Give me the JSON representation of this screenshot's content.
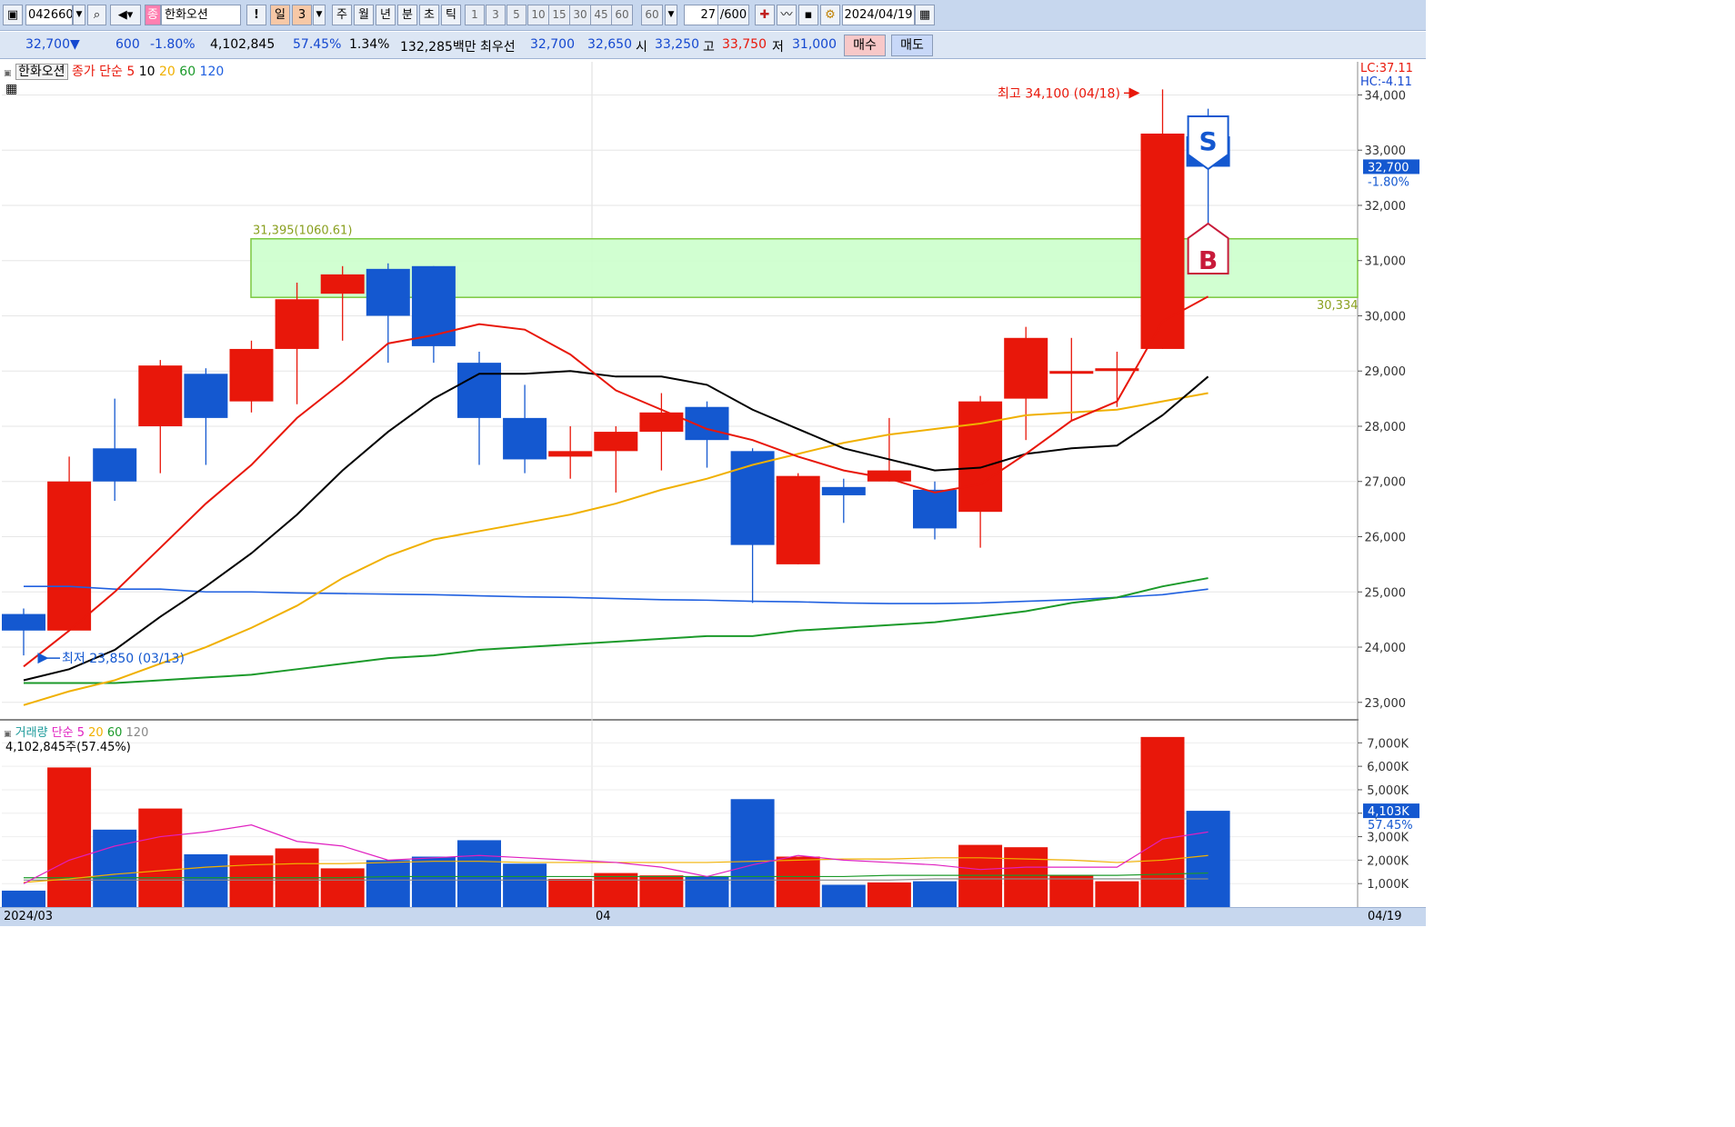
{
  "toolbar": {
    "code": "042660",
    "market_badge": "종",
    "name": "한화오션",
    "alert": "!",
    "period_day": "일",
    "period_n": "3",
    "periods": [
      "주",
      "월",
      "년",
      "분",
      "초",
      "틱"
    ],
    "intervals": [
      "1",
      "3",
      "5",
      "10",
      "15",
      "30",
      "45",
      "60"
    ],
    "interval_custom": "60",
    "count": "27",
    "count_max": "/600",
    "date": "2024/04/19"
  },
  "quote": {
    "price": "32,700▼",
    "change": "600",
    "change_pct": "-1.80%",
    "volume": "4,102,845",
    "vol_ratio": "57.45%",
    "turnover": "1.34%",
    "amount": "132,285백만",
    "best_label": "최우선",
    "best_ask": "32,700",
    "best_bid": "32,650",
    "open_label": "시",
    "open": "33,250",
    "high_label": "고",
    "high": "33,750",
    "low_label": "저",
    "low": "31,000",
    "buy_button": "매수",
    "sell_button": "매도"
  },
  "price_legend": {
    "name": "한화오션",
    "close_label": "종가 단순",
    "ma_periods": [
      "5",
      "10",
      "20",
      "60",
      "120"
    ],
    "ma_colors": [
      "#e8170a",
      "#000000",
      "#f0b000",
      "#1b9a2a",
      "#2060e0"
    ],
    "lc": "LC:37.11",
    "hc": "HC:-4.11"
  },
  "annotations": {
    "high_marker": "최고 34,100 (04/18)",
    "low_marker": "최저 23,850 (03/13)",
    "box_top_label": "31,395(1060.61)",
    "box_bottom_label": "30,334",
    "sell_signal": "S",
    "buy_signal": "B"
  },
  "axis_badges": {
    "price": "32,700",
    "price_pct": "-1.80%",
    "volume": "4,103K",
    "volume_pct": "57.45%"
  },
  "volume_legend": {
    "name": "거래량",
    "ma_label": "단순",
    "ma_periods": [
      "5",
      "20",
      "60",
      "120"
    ],
    "ma_colors": [
      "#e020c0",
      "#f0b000",
      "#1b9a2a",
      "#888888"
    ],
    "summary": "4,102,845주(57.45%)"
  },
  "dates": {
    "start": "2024/03",
    "mid": "04",
    "end": "04/19"
  },
  "colors": {
    "up": "#e8170a",
    "down": "#1458d0",
    "box": "#ccffcc"
  },
  "chart_data": {
    "type": "candlestick",
    "x_unit": "trading day",
    "candles": [
      {
        "open": 24600,
        "high": 24700,
        "low": 23850,
        "close": 24300
      },
      {
        "open": 24300,
        "high": 27450,
        "low": 24300,
        "close": 27000
      },
      {
        "open": 27600,
        "high": 28500,
        "low": 26650,
        "close": 27000
      },
      {
        "open": 28000,
        "high": 29200,
        "low": 27150,
        "close": 29100
      },
      {
        "open": 28950,
        "high": 29050,
        "low": 27300,
        "close": 28150
      },
      {
        "open": 28450,
        "high": 29550,
        "low": 28250,
        "close": 29400
      },
      {
        "open": 29400,
        "high": 30600,
        "low": 28400,
        "close": 30300
      },
      {
        "open": 30400,
        "high": 30900,
        "low": 29550,
        "close": 30750
      },
      {
        "open": 30850,
        "high": 30950,
        "low": 29150,
        "close": 30000
      },
      {
        "open": 30900,
        "high": 30900,
        "low": 29150,
        "close": 29450
      },
      {
        "open": 29150,
        "high": 29350,
        "low": 27300,
        "close": 28150
      },
      {
        "open": 28150,
        "high": 28750,
        "low": 27150,
        "close": 27400
      },
      {
        "open": 27450,
        "high": 28000,
        "low": 27050,
        "close": 27550
      },
      {
        "open": 27550,
        "high": 28000,
        "low": 26800,
        "close": 27900
      },
      {
        "open": 27900,
        "high": 28600,
        "low": 27200,
        "close": 28250
      },
      {
        "open": 28350,
        "high": 28450,
        "low": 27250,
        "close": 27750
      },
      {
        "open": 27550,
        "high": 27600,
        "low": 24800,
        "close": 25850
      },
      {
        "open": 25500,
        "high": 27150,
        "low": 25500,
        "close": 27100
      },
      {
        "open": 26900,
        "high": 27050,
        "low": 26250,
        "close": 26750
      },
      {
        "open": 27000,
        "high": 28150,
        "low": 27000,
        "close": 27200
      },
      {
        "open": 26850,
        "high": 27000,
        "low": 25950,
        "close": 26150
      },
      {
        "open": 26450,
        "high": 28550,
        "low": 25800,
        "close": 28450
      },
      {
        "open": 28500,
        "high": 29800,
        "low": 27750,
        "close": 29600
      },
      {
        "open": 29000,
        "high": 29600,
        "low": 28100,
        "close": 29000
      },
      {
        "open": 29000,
        "high": 29350,
        "low": 28350,
        "close": 29050
      },
      {
        "open": 29400,
        "high": 34100,
        "low": 29400,
        "close": 33300
      },
      {
        "open": 33250,
        "high": 33750,
        "low": 31000,
        "close": 32700
      }
    ],
    "ma5": [
      23650,
      24300,
      25000,
      25800,
      26600,
      27300,
      28150,
      28800,
      29500,
      29650,
      29850,
      29750,
      29300,
      28650,
      28300,
      27950,
      27750,
      27450,
      27200,
      27050,
      26800,
      26950,
      27500,
      28100,
      28450,
      29900,
      30350
    ],
    "ma10": [
      23400,
      23600,
      23950,
      24550,
      25100,
      25700,
      26400,
      27200,
      27900,
      28500,
      28950,
      28950,
      29000,
      28900,
      28900,
      28750,
      28300,
      27950,
      27600,
      27400,
      27200,
      27250,
      27500,
      27600,
      27650,
      28200,
      28900
    ],
    "ma20": [
      22950,
      23200,
      23400,
      23700,
      24000,
      24350,
      24750,
      25250,
      25650,
      25950,
      26100,
      26250,
      26400,
      26600,
      26850,
      27050,
      27300,
      27500,
      27700,
      27850,
      27950,
      28050,
      28200,
      28250,
      28300,
      28450,
      28600
    ],
    "ma60": [
      23350,
      23350,
      23350,
      23400,
      23450,
      23500,
      23600,
      23700,
      23800,
      23850,
      23950,
      24000,
      24050,
      24100,
      24150,
      24200,
      24200,
      24300,
      24350,
      24400,
      24450,
      24550,
      24650,
      24800,
      24900,
      25100,
      25250
    ],
    "ma120": [
      25100,
      25100,
      25050,
      25050,
      25000,
      25000,
      24980,
      24970,
      24960,
      24950,
      24930,
      24910,
      24900,
      24880,
      24860,
      24850,
      24830,
      24820,
      24800,
      24790,
      24790,
      24800,
      24830,
      24860,
      24900,
      24950,
      25050
    ],
    "volume_k": [
      700,
      5950,
      3300,
      4200,
      2250,
      2200,
      2500,
      1650,
      2000,
      2150,
      2850,
      1850,
      1200,
      1450,
      1350,
      1300,
      4600,
      2150,
      950,
      1050,
      1100,
      2650,
      2550,
      1350,
      1100,
      7250,
      4103
    ],
    "vol_ma5": [
      1000,
      2000,
      2600,
      3000,
      3200,
      3500,
      2800,
      2600,
      2000,
      2100,
      2200,
      2100,
      2000,
      1900,
      1700,
      1300,
      1800,
      2200,
      2000,
      1900,
      1800,
      1600,
      1700,
      1700,
      1700,
      2900,
      3200
    ],
    "vol_ma20": [
      1050,
      1200,
      1400,
      1550,
      1700,
      1800,
      1850,
      1850,
      1900,
      1950,
      1950,
      1900,
      1900,
      1900,
      1900,
      1900,
      1950,
      2000,
      2050,
      2050,
      2100,
      2100,
      2050,
      2000,
      1900,
      2000,
      2200
    ],
    "vol_ma60": [
      1250,
      1250,
      1250,
      1250,
      1250,
      1250,
      1250,
      1250,
      1300,
      1300,
      1300,
      1300,
      1300,
      1300,
      1300,
      1300,
      1300,
      1300,
      1300,
      1350,
      1350,
      1350,
      1350,
      1350,
      1350,
      1400,
      1450
    ],
    "vol_ma120": [
      1150,
      1150,
      1150,
      1150,
      1150,
      1150,
      1150,
      1150,
      1150,
      1150,
      1150,
      1150,
      1150,
      1150,
      1150,
      1150,
      1150,
      1150,
      1150,
      1150,
      1200,
      1200,
      1200,
      1200,
      1200,
      1200,
      1200
    ],
    "price_ylim": [
      22700,
      34600
    ],
    "price_ticks": [
      "34,000",
      "33,000",
      "32,000",
      "31,000",
      "30,000",
      "29,000",
      "28,000",
      "27,000",
      "26,000",
      "25,000",
      "24,000",
      "23,000"
    ],
    "price_tick_values": [
      34000,
      33000,
      32000,
      31000,
      30000,
      29000,
      28000,
      27000,
      26000,
      25000,
      24000,
      23000
    ],
    "volume_ylim": [
      0,
      7400
    ],
    "volume_ticks": [
      "7,000K",
      "6,000K",
      "5,000K",
      "4,000K",
      "3,000K",
      "2,000K",
      "1,000K"
    ],
    "volume_tick_values": [
      7000,
      6000,
      5000,
      4000,
      3000,
      2000,
      1000
    ],
    "box_range": [
      30334,
      31395
    ]
  }
}
